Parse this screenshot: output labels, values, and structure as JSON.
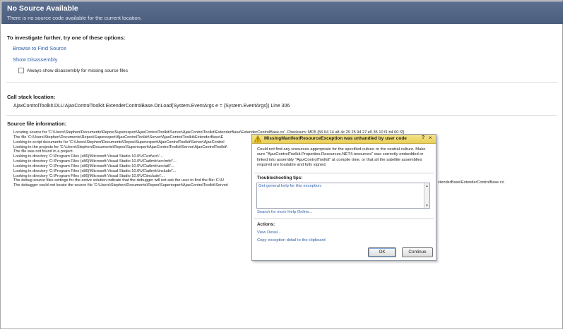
{
  "header": {
    "title": "No Source Available",
    "subtitle": "There is no source code available for the current location."
  },
  "investigate": {
    "heading": "To investigate further, try one of these options:",
    "browse_link": "Browse to Find Source",
    "disassembly_link": "Show Disassembly",
    "checkbox_label": "Always show disassembly for missing source files",
    "checkbox_checked": false
  },
  "callstack": {
    "heading": "Call stack location:",
    "value": "AjaxControlToolkit.DLL!AjaxControlToolkit.ExtenderControlBase.OnLoad(System.EventArgs e = {System.EventArgs}) Line 306"
  },
  "source_info": {
    "heading": "Source file information:",
    "lines": [
      "Locating source for 'C:\\Users\\Stephen\\Documents\\Repos\\Superexpert\\AjaxControlToolkit\\Server\\AjaxControlToolkit\\ExtenderBase\\ExtenderControlBase.cs'. Checksum: MD5 {56 64 14 a8 4c 29 25 94 27 e0 35 10 f1 b4 60 f2}",
      "The file 'C:\\Users\\Stephen\\Documents\\Repos\\Superexpert\\AjaxControlToolkit\\Server\\AjaxControlToolkit\\ExtenderBase\\E",
      "Looking in script documents for 'C:\\Users\\Stephen\\Documents\\Repos\\Superexpert\\AjaxControlToolkit\\Server\\AjaxControl",
      "Looking in the projects for 'C:\\Users\\Stephen\\Documents\\Repos\\Superexpert\\AjaxControlToolkit\\Server\\AjaxControlToolkit\\",
      "The file was not found in a project.",
      "Looking in directory 'C:\\Program Files (x86)\\Microsoft Visual Studio 10.0\\VC\\crt\\src\\'...",
      "Looking in directory 'C:\\Program Files (x86)\\Microsoft Visual Studio 10.0\\VC\\atlmfc\\src\\mfc\\'...",
      "Looking in directory 'C:\\Program Files (x86)\\Microsoft Visual Studio 10.0\\VC\\atlmfc\\src\\atl\\'...",
      "Looking in directory 'C:\\Program Files (x86)\\Microsoft Visual Studio 10.0\\VC\\atlmfc\\include\\'...",
      "Looking in directory 'C:\\Program Files (x86)\\Microsoft Visual Studio 10.0\\VC\\include\\'...",
      "The debug source files settings for the active solution indicate that the debugger will not ask the user to find the file: C:\\U",
      "The debugger could not locate the source file 'C:\\Users\\Stephen\\Documents\\Repos\\Superexpert\\AjaxControlToolkit\\Server\\"
    ],
    "tail_fragment": "xtenderBase\\ExtenderControlBase.cs'."
  },
  "dialog": {
    "title": "MissingManifestResourceException was unhandled by user code",
    "help_glyph": "?",
    "close_glyph": "×",
    "message": "Could not find any resources appropriate for the specified culture or the neutral culture. Make sure \"AjaxControlToolkit.Properties.Resources.NET4.resources\" was correctly embedded or linked into assembly \"AjaxControlToolkit\" at compile time, or that all the satellite assemblies required are loadable and fully signed.",
    "tips_heading": "Troubleshooting tips:",
    "tips_link": "Get general help for this exception.",
    "search_link": "Search for more Help Online...",
    "actions_heading": "Actions:",
    "view_detail": "View Detail...",
    "copy_detail": "Copy exception detail to the clipboard",
    "ok_label": "OK",
    "continue_label": "Continue"
  },
  "colors": {
    "header_bg": "#55678a",
    "link": "#2e5fa8",
    "dialog_title_bg": "#efd96a"
  }
}
